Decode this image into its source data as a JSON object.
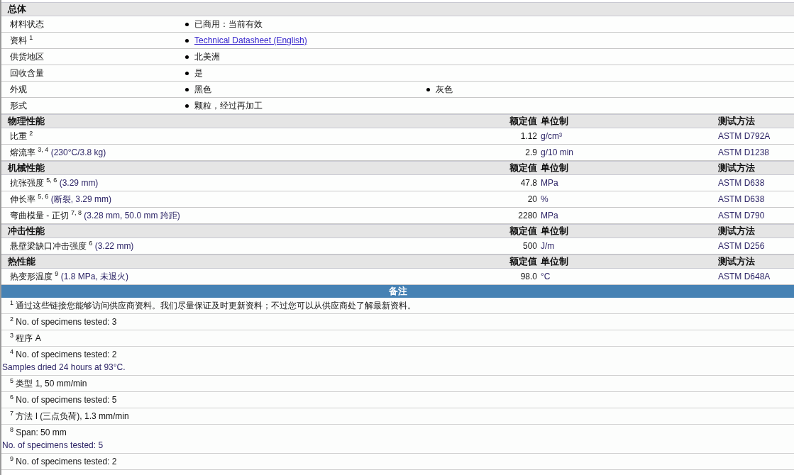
{
  "sections": [
    {
      "title": "总体",
      "kind": "general",
      "rows": [
        {
          "label": "材料状态",
          "values": [
            {
              "kind": "text",
              "text": "已商用：当前有效"
            }
          ]
        },
        {
          "label": "资料 $^{1}$",
          "values": [
            {
              "kind": "link",
              "text": "Technical Datasheet (English)"
            }
          ]
        },
        {
          "label": "供货地区",
          "values": [
            {
              "kind": "text",
              "text": "北美洲"
            }
          ]
        },
        {
          "label": "回收含量",
          "values": [
            {
              "kind": "text",
              "text": "是"
            }
          ]
        },
        {
          "label": "外观",
          "values": [
            {
              "kind": "text",
              "text": "黑色"
            },
            {
              "kind": "text",
              "text": "灰色"
            }
          ]
        },
        {
          "label": "形式",
          "values": [
            {
              "kind": "text",
              "text": "颗粒，经过再加工"
            }
          ]
        }
      ]
    },
    {
      "title": "物理性能",
      "kind": "property",
      "columns": [
        "额定值",
        "单位制",
        "测试方法"
      ],
      "rows": [
        {
          "label": "比重 $^{2}$",
          "value": "1.12",
          "unit": "g/cm³",
          "method": "ASTM D792A"
        },
        {
          "label": "熔流率 $^{3, 4}$",
          "condition": "(230°C/3.8 kg)",
          "value": "2.9",
          "unit": "g/10 min",
          "method": "ASTM D1238"
        }
      ]
    },
    {
      "title": "机械性能",
      "kind": "property",
      "columns": [
        "额定值",
        "单位制",
        "测试方法"
      ],
      "rows": [
        {
          "label": "抗张强度 $^{5, 6}$",
          "condition": "(3.29 mm)",
          "value": "47.8",
          "unit": "MPa",
          "method": "ASTM D638"
        },
        {
          "label": "伸长率 $^{5, 6}$",
          "condition": "(断裂, 3.29 mm)",
          "value": "20",
          "unit": "%",
          "method": "ASTM D638"
        },
        {
          "label": "弯曲模量  - 正切 $^{7, 8}$",
          "condition": "(3.28 mm, 50.0 mm 跨距)",
          "value": "2280",
          "unit": "MPa",
          "method": "ASTM D790"
        }
      ]
    },
    {
      "title": "冲击性能",
      "kind": "property",
      "columns": [
        "额定值",
        "单位制",
        "测试方法"
      ],
      "rows": [
        {
          "label": "悬壁梁缺口冲击强度 $^{6}$",
          "condition": "(3.22 mm)",
          "value": "500",
          "unit": "J/m",
          "method": "ASTM D256"
        }
      ]
    },
    {
      "title": "热性能",
      "kind": "property",
      "columns": [
        "额定值",
        "单位制",
        "测试方法"
      ],
      "rows": [
        {
          "label": "热变形温度 $^{9}$",
          "condition": "(1.8 MPa, 未退火)",
          "value": "98.0",
          "unit": "°C",
          "method": "ASTM D648A"
        }
      ]
    }
  ],
  "notes_title": "备注",
  "notes": [
    {
      "mark": "1",
      "lines": [
        "通过这些链接您能够访问供应商资料。我们尽量保证及时更新资料；不过您可以从供应商处了解最新资料。"
      ]
    },
    {
      "mark": "2",
      "lines": [
        "No. of specimens tested: 3"
      ]
    },
    {
      "mark": "3",
      "lines": [
        "程序  A"
      ]
    },
    {
      "mark": "4",
      "lines": [
        "No. of specimens tested: 2",
        "Samples dried 24 hours at 93°C."
      ]
    },
    {
      "mark": "5",
      "lines": [
        "类型  1, 50 mm/min"
      ]
    },
    {
      "mark": "6",
      "lines": [
        "No. of specimens tested: 5"
      ]
    },
    {
      "mark": "7",
      "lines": [
        "方法  I (三点负荷), 1.3 mm/min"
      ]
    },
    {
      "mark": "8",
      "lines": [
        "Span: 50 mm",
        "No. of specimens tested: 5"
      ]
    },
    {
      "mark": "9",
      "lines": [
        "No. of specimens tested: 2"
      ]
    }
  ]
}
